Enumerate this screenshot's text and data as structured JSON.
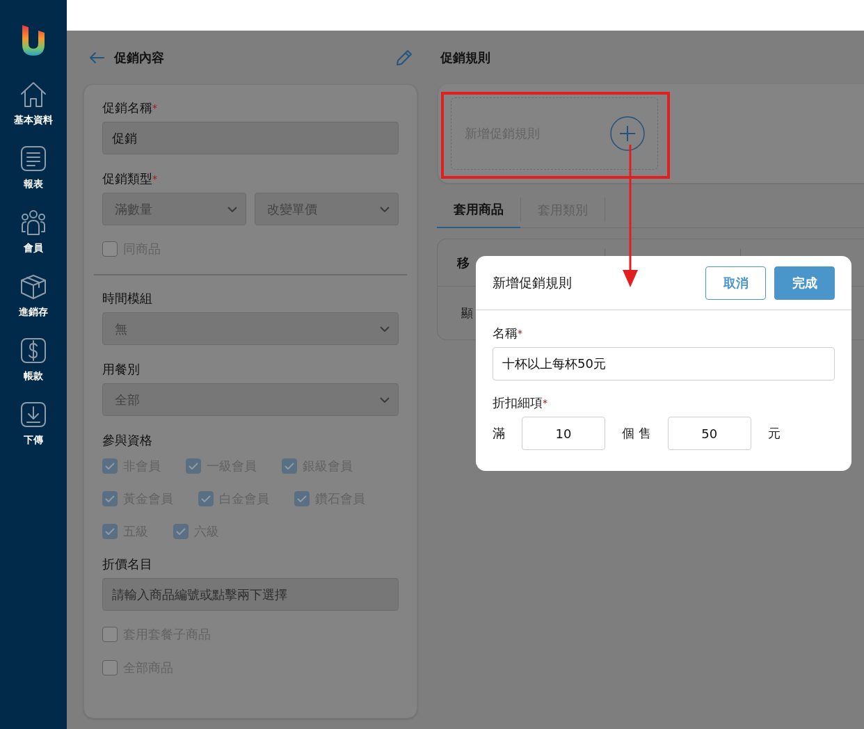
{
  "sidebar": {
    "items": [
      {
        "label": "基本資料"
      },
      {
        "label": "報表"
      },
      {
        "label": "會員"
      },
      {
        "label": "進銷存"
      },
      {
        "label": "帳款"
      },
      {
        "label": "下傳"
      }
    ]
  },
  "promotion": {
    "title": "促銷內容",
    "name": {
      "label": "促銷名稱",
      "required_mark": "*",
      "value": "促銷"
    },
    "type": {
      "label": "促銷類型",
      "required_mark": "*",
      "selects": [
        {
          "value": "滿數量",
          "disabled": true
        },
        {
          "value": "改變單價",
          "disabled": true
        }
      ]
    },
    "same_item": {
      "label": "同商品",
      "checked": false,
      "disabled": true
    },
    "time_module": {
      "label": "時間模組",
      "value": "無",
      "disabled": true
    },
    "meal_type": {
      "label": "用餐別",
      "value": "全部",
      "disabled": true
    },
    "eligibility": {
      "label": "參與資格",
      "options": [
        {
          "label": "非會員",
          "checked": true,
          "disabled": true
        },
        {
          "label": "一級會員",
          "checked": true,
          "disabled": true
        },
        {
          "label": "銀級會員",
          "checked": true,
          "disabled": true
        },
        {
          "label": "黃金會員",
          "checked": true,
          "disabled": true
        },
        {
          "label": "白金會員",
          "checked": true,
          "disabled": true
        },
        {
          "label": "鑽石會員",
          "checked": true,
          "disabled": true
        },
        {
          "label": "五級",
          "checked": true,
          "disabled": true
        },
        {
          "label": "六級",
          "checked": true,
          "disabled": true
        }
      ]
    },
    "discount_items": {
      "label": "折價名目",
      "placeholder": "請輸入商品編號或點擊兩下選擇"
    },
    "options": [
      {
        "label": "套用套餐子商品",
        "checked": false,
        "disabled": true
      },
      {
        "label": "全部商品",
        "checked": false,
        "disabled": true
      }
    ]
  },
  "rules": {
    "title": "促銷規則",
    "add_rule": {
      "label": "新增促銷規則"
    },
    "tabs": [
      {
        "label": "套用商品",
        "selected": true
      },
      {
        "label": "套用類別",
        "selected": false
      }
    ],
    "table": {
      "header": [
        "移"
      ],
      "row": [
        "顯"
      ]
    }
  },
  "dialog": {
    "title": "新增促銷規則",
    "buttons": [
      {
        "label": "取消",
        "kind": "secondary"
      },
      {
        "label": "完成",
        "kind": "primary"
      }
    ],
    "name": {
      "label": "名稱",
      "required_mark": "*",
      "value": "十杯以上每杯50元"
    },
    "detail": {
      "label": "折扣細項",
      "required_mark": "*",
      "prefix": "滿",
      "quantity": "10",
      "middle": "個 售",
      "price": "50",
      "suffix": "元"
    }
  }
}
